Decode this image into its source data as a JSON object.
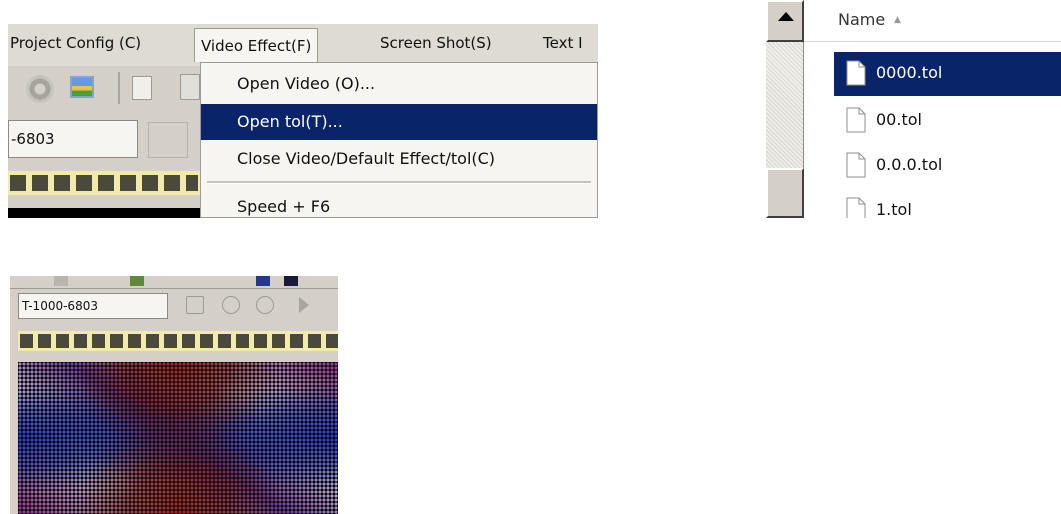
{
  "menubar": {
    "items": [
      "Project Config (C)",
      "Video Effect(F)",
      "Screen Shot(S)",
      "Text I"
    ]
  },
  "video_menu": {
    "items": [
      "Open Video (O)...",
      "Open tol(T)...",
      "Close Video/Default Effect/tol(C)",
      "Speed + F6"
    ],
    "selected": "Open tol(T)..."
  },
  "toolbar": {
    "field_value": "-6803"
  },
  "file_list": {
    "column_header": "Name",
    "files": [
      "0000.tol",
      "00.tol",
      "0.0.0.tol",
      "1.tol"
    ],
    "selected": "0000.tol"
  },
  "preview": {
    "field_value": "T-1000-6803"
  },
  "colors": {
    "selection": "#0a246a",
    "panel_bg": "#d4d0c8",
    "timeline_strip": "#f1eaa8"
  }
}
